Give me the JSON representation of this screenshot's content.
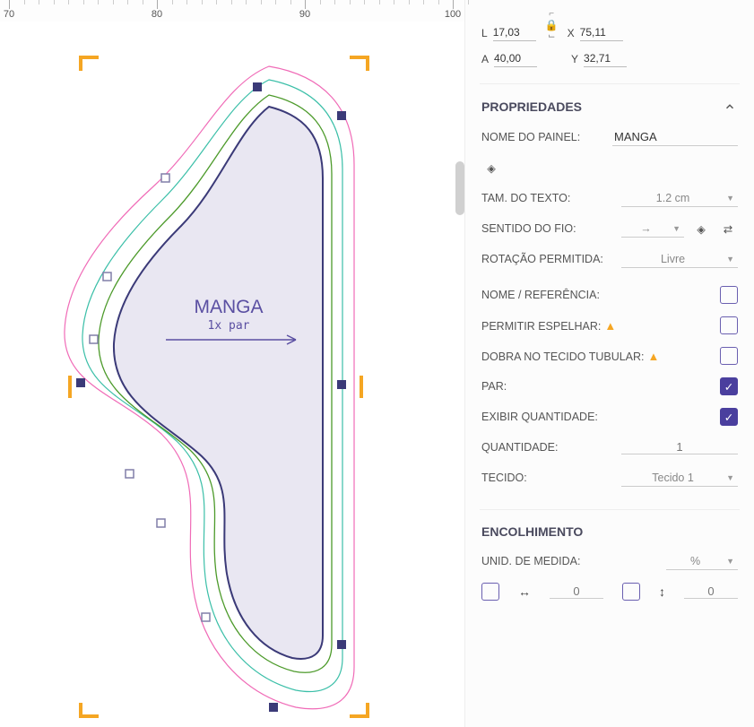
{
  "ruler": {
    "ticks": [
      70,
      80,
      90,
      100
    ]
  },
  "canvas_label": {
    "title": "MANGA",
    "subtitle": "1x par"
  },
  "dims": {
    "L_label": "L",
    "L": "17,03",
    "A_label": "A",
    "A": "40,00",
    "X_label": "X",
    "X": "75,11",
    "Y_label": "Y",
    "Y": "32,71"
  },
  "sections": {
    "properties": {
      "title": "PROPRIEDADES",
      "panel_name_label": "NOME DO PAINEL:",
      "panel_name_value": "MANGA",
      "text_size_label": "TAM. DO TEXTO:",
      "text_size_value": "1.2 cm",
      "grain_label": "SENTIDO DO FIO:",
      "grain_value": "→",
      "rotation_label": "ROTAÇÃO PERMITIDA:",
      "rotation_value": "Livre",
      "name_ref_label": "NOME / REFERÊNCIA:",
      "mirror_label": "PERMITIR ESPELHAR:",
      "tubular_label": "DOBRA NO TECIDO TUBULAR:",
      "pair_label": "PAR:",
      "show_qty_label": "EXIBIR QUANTIDADE:",
      "qty_label": "QUANTIDADE:",
      "qty_value": "1",
      "fabric_label": "TECIDO:",
      "fabric_value": "Tecido 1"
    },
    "shrinkage": {
      "title": "ENCOLHIMENTO",
      "unit_label": "UNID. DE MEDIDA:",
      "unit_value": "%",
      "h_value": "0",
      "v_value": "0"
    }
  },
  "checkboxes": {
    "name_ref": false,
    "mirror": false,
    "tubular": false,
    "pair": true,
    "show_qty": true,
    "shrink_h": false,
    "shrink_v": false
  }
}
